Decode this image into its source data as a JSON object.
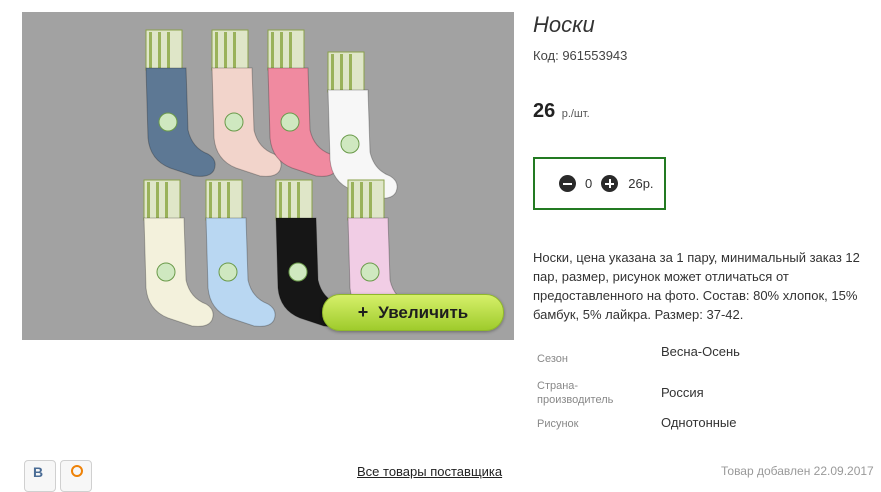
{
  "product": {
    "title": "Носки",
    "code": "Код: 961553943",
    "price": "26",
    "price_unit": "р./шт.",
    "zoom_button": "Увеличить",
    "zoom_plus": "+",
    "quantity": "0",
    "total": "26р.",
    "description": "Носки, цена указана за 1 пару, минимальный заказ 12 пар, размер, рисунок может отличаться от предоставленного на фото. Состав: 80% хлопок, 15% бамбук, 5% лайкра. Размер: 37-42.",
    "specs": [
      {
        "label": "Сезон",
        "value": "Весна-Осень"
      },
      {
        "label": "Страна-производитель",
        "value": "Россия"
      },
      {
        "label": "Рисунок",
        "value": "Однотонные"
      }
    ]
  },
  "footer": {
    "vk_letter": "В",
    "all_goods_link": "Все товары поставщика",
    "added": "Товар добавлен 22.09.2017"
  },
  "image": {
    "sock_colors": [
      "#5d7894",
      "#f2d4cb",
      "#f08aa0",
      "#f7f7f7",
      "#f3f1dc",
      "#b9d7f2",
      "#161616",
      "#f1cde5"
    ]
  },
  "colors": {
    "accent_border": "#237a22",
    "zoom_button": "#aed23a",
    "photo_background": "#a2a2a2"
  }
}
